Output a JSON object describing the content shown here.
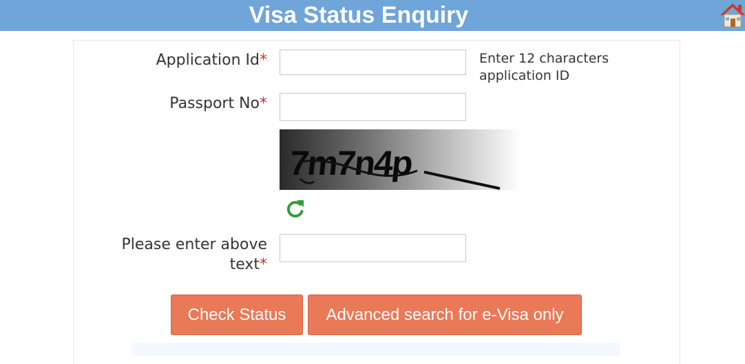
{
  "header": {
    "title": "Visa Status Enquiry",
    "home_icon": "home-icon"
  },
  "form": {
    "application_id": {
      "label": "Application Id",
      "required_mark": "*",
      "value": "",
      "hint_line1": "Enter 12 characters",
      "hint_line2": "application ID"
    },
    "passport_no": {
      "label": "Passport No",
      "required_mark": "*",
      "value": ""
    },
    "captcha": {
      "text": "7m7n4p",
      "refresh_icon": "refresh-icon"
    },
    "captcha_input": {
      "label_line1": "Please enter above",
      "label_line2": "text",
      "required_mark": "*",
      "value": ""
    }
  },
  "buttons": {
    "check_status": "Check Status",
    "advanced_search": "Advanced search for e-Visa only"
  },
  "colors": {
    "header_bg": "#6fa5d8",
    "button_bg": "#ea7957",
    "required": "#b53a2f",
    "refresh": "#2e9d3a"
  }
}
